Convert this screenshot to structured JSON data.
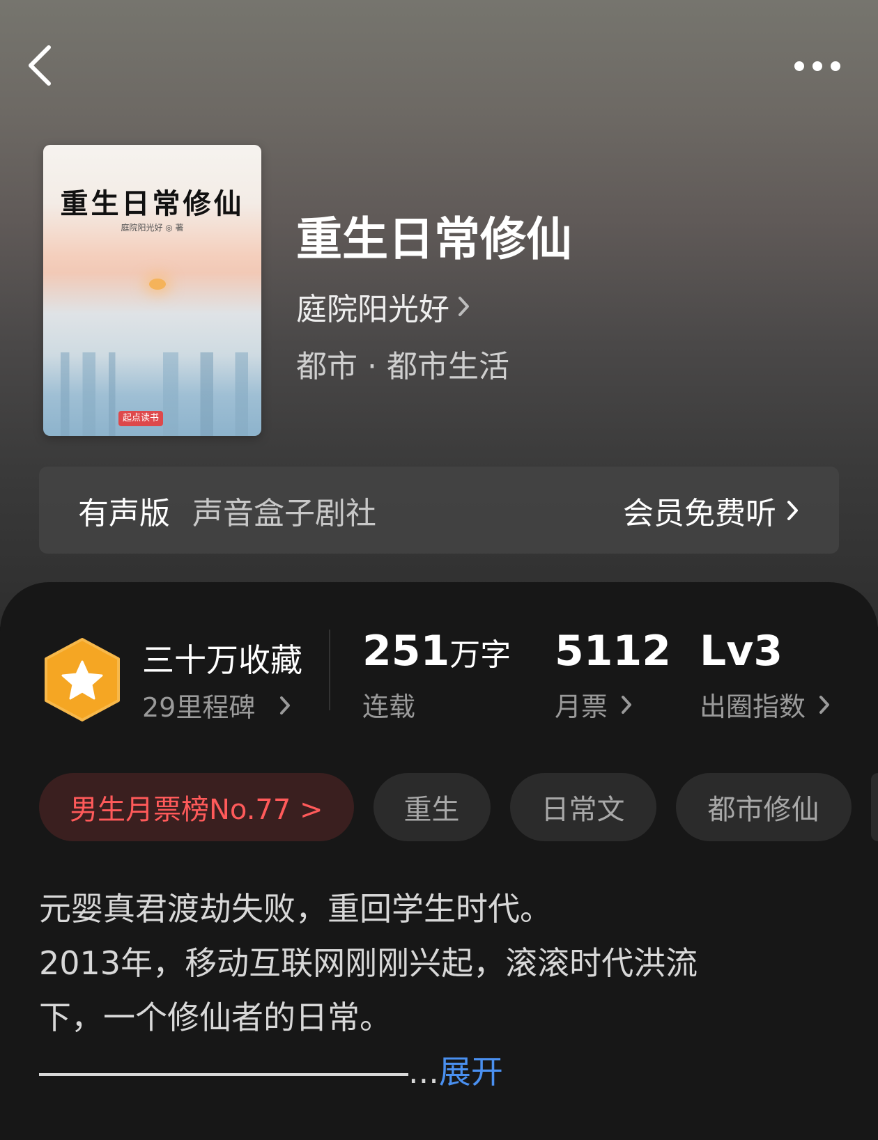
{
  "book": {
    "title": "重生日常修仙",
    "author": "庭院阳光好",
    "category": "都市 · 都市生活",
    "cover": {
      "title": "重生日常修仙",
      "author": "庭院阳光好 ◎ 著",
      "publisher": "起点读书"
    }
  },
  "audio": {
    "label": "有声版",
    "studio": "声音盒子剧社",
    "cta": "会员免费听"
  },
  "stats": {
    "collect_title": "三十万收藏",
    "collect_sub": "29里程碑",
    "words_value": "251",
    "words_unit": "万字",
    "words_label": "连载",
    "tickets_value": "5112",
    "tickets_label": "月票",
    "level_value": "Lv3",
    "level_label": "出圈指数"
  },
  "tags": {
    "rank": "男生月票榜No.77 >",
    "items": [
      "重生",
      "日常文",
      "都市修仙"
    ]
  },
  "synopsis": {
    "line1": "元婴真君渡劫失败，重回学生时代。",
    "line2": "2013年，移动互联网刚刚兴起，滚滚时代洪流",
    "line3": "下，一个修仙者的日常。",
    "ellipsis": "...",
    "expand": "展开"
  },
  "colors": {
    "accent_blue": "#4a90f0",
    "rank_red": "#ff5a5a",
    "badge_orange": "#f5a623"
  },
  "icons": [
    "back-arrow-icon",
    "more-dots-icon",
    "chevron-right-icon",
    "star-badge-icon"
  ]
}
